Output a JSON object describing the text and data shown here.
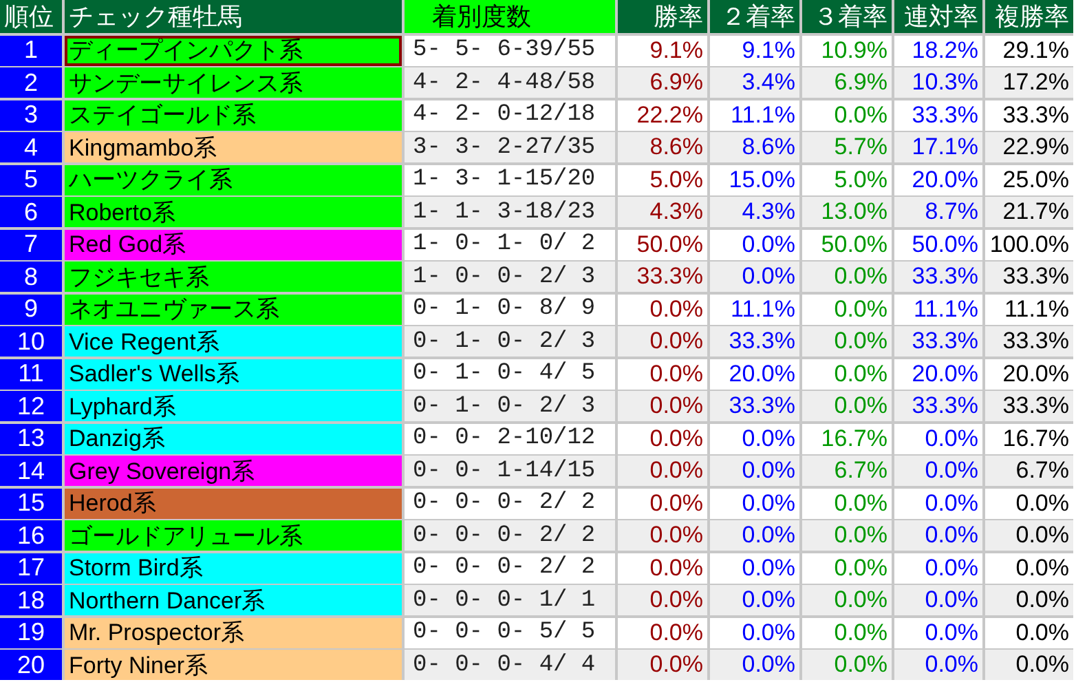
{
  "columns": [
    {
      "label": "順位",
      "kind": "rank"
    },
    {
      "label": "チェック種牡馬",
      "kind": "name"
    },
    {
      "label": "着別度数",
      "kind": "record"
    },
    {
      "label": "勝率",
      "kind": "rate",
      "color": "#990000"
    },
    {
      "label": "２着率",
      "kind": "rate",
      "color": "#0000ff"
    },
    {
      "label": "３着率",
      "kind": "rate",
      "color": "#009900"
    },
    {
      "label": "連対率",
      "kind": "rate",
      "color": "#0000ff"
    },
    {
      "label": "複勝率",
      "kind": "rate",
      "color": "#000000"
    }
  ],
  "rows": [
    {
      "rank": "1",
      "name": "ディープインパクト系",
      "color": "#00ff00",
      "selected": true,
      "record": "5- 5- 6-39/55",
      "rates": [
        "9.1%",
        "9.1%",
        "10.9%",
        "18.2%",
        "29.1%"
      ]
    },
    {
      "rank": "2",
      "name": "サンデーサイレンス系",
      "color": "#00ff00",
      "selected": false,
      "record": "4- 2- 4-48/58",
      "rates": [
        "6.9%",
        "3.4%",
        "6.9%",
        "10.3%",
        "17.2%"
      ]
    },
    {
      "rank": "3",
      "name": "ステイゴールド系",
      "color": "#00ff00",
      "selected": false,
      "record": "4- 2- 0-12/18",
      "rates": [
        "22.2%",
        "11.1%",
        "0.0%",
        "33.3%",
        "33.3%"
      ]
    },
    {
      "rank": "4",
      "name": "Kingmambo系",
      "color": "#ffcc88",
      "selected": false,
      "record": "3- 3- 2-27/35",
      "rates": [
        "8.6%",
        "8.6%",
        "5.7%",
        "17.1%",
        "22.9%"
      ]
    },
    {
      "rank": "5",
      "name": "ハーツクライ系",
      "color": "#00ff00",
      "selected": false,
      "record": "1- 3- 1-15/20",
      "rates": [
        "5.0%",
        "15.0%",
        "5.0%",
        "20.0%",
        "25.0%"
      ]
    },
    {
      "rank": "6",
      "name": "Roberto系",
      "color": "#00ff00",
      "selected": false,
      "record": "1- 1- 3-18/23",
      "rates": [
        "4.3%",
        "4.3%",
        "13.0%",
        "8.7%",
        "21.7%"
      ]
    },
    {
      "rank": "7",
      "name": "Red God系",
      "color": "#ff00ff",
      "selected": false,
      "record": "1- 0- 1- 0/ 2",
      "rates": [
        "50.0%",
        "0.0%",
        "50.0%",
        "50.0%",
        "100.0%"
      ]
    },
    {
      "rank": "8",
      "name": "フジキセキ系",
      "color": "#00ff00",
      "selected": false,
      "record": "1- 0- 0- 2/ 3",
      "rates": [
        "33.3%",
        "0.0%",
        "0.0%",
        "33.3%",
        "33.3%"
      ]
    },
    {
      "rank": "9",
      "name": "ネオユニヴァース系",
      "color": "#00ff00",
      "selected": false,
      "record": "0- 1- 0- 8/ 9",
      "rates": [
        "0.0%",
        "11.1%",
        "0.0%",
        "11.1%",
        "11.1%"
      ]
    },
    {
      "rank": "10",
      "name": "Vice Regent系",
      "color": "#00ffff",
      "selected": false,
      "record": "0- 1- 0- 2/ 3",
      "rates": [
        "0.0%",
        "33.3%",
        "0.0%",
        "33.3%",
        "33.3%"
      ]
    },
    {
      "rank": "11",
      "name": "Sadler's Wells系",
      "color": "#00ffff",
      "selected": false,
      "record": "0- 1- 0- 4/ 5",
      "rates": [
        "0.0%",
        "20.0%",
        "0.0%",
        "20.0%",
        "20.0%"
      ]
    },
    {
      "rank": "12",
      "name": "Lyphard系",
      "color": "#00ffff",
      "selected": false,
      "record": "0- 1- 0- 2/ 3",
      "rates": [
        "0.0%",
        "33.3%",
        "0.0%",
        "33.3%",
        "33.3%"
      ]
    },
    {
      "rank": "13",
      "name": "Danzig系",
      "color": "#00ffff",
      "selected": false,
      "record": "0- 0- 2-10/12",
      "rates": [
        "0.0%",
        "0.0%",
        "16.7%",
        "0.0%",
        "16.7%"
      ]
    },
    {
      "rank": "14",
      "name": "Grey Sovereign系",
      "color": "#ff00ff",
      "selected": false,
      "record": "0- 0- 1-14/15",
      "rates": [
        "0.0%",
        "0.0%",
        "6.7%",
        "0.0%",
        "6.7%"
      ]
    },
    {
      "rank": "15",
      "name": "Herod系",
      "color": "#cc6633",
      "selected": false,
      "record": "0- 0- 0- 2/ 2",
      "rates": [
        "0.0%",
        "0.0%",
        "0.0%",
        "0.0%",
        "0.0%"
      ]
    },
    {
      "rank": "16",
      "name": "ゴールドアリュール系",
      "color": "#00ff00",
      "selected": false,
      "record": "0- 0- 0- 2/ 2",
      "rates": [
        "0.0%",
        "0.0%",
        "0.0%",
        "0.0%",
        "0.0%"
      ]
    },
    {
      "rank": "17",
      "name": "Storm Bird系",
      "color": "#00ffff",
      "selected": false,
      "record": "0- 0- 0- 2/ 2",
      "rates": [
        "0.0%",
        "0.0%",
        "0.0%",
        "0.0%",
        "0.0%"
      ]
    },
    {
      "rank": "18",
      "name": "Northern Dancer系",
      "color": "#00ffff",
      "selected": false,
      "record": "0- 0- 0- 1/ 1",
      "rates": [
        "0.0%",
        "0.0%",
        "0.0%",
        "0.0%",
        "0.0%"
      ]
    },
    {
      "rank": "19",
      "name": "Mr. Prospector系",
      "color": "#ffcc88",
      "selected": false,
      "record": "0- 0- 0- 5/ 5",
      "rates": [
        "0.0%",
        "0.0%",
        "0.0%",
        "0.0%",
        "0.0%"
      ]
    },
    {
      "rank": "20",
      "name": "Forty Niner系",
      "color": "#ffcc88",
      "selected": false,
      "record": "0- 0- 0- 4/ 4",
      "rates": [
        "0.0%",
        "0.0%",
        "0.0%",
        "0.0%",
        "0.0%"
      ]
    }
  ]
}
